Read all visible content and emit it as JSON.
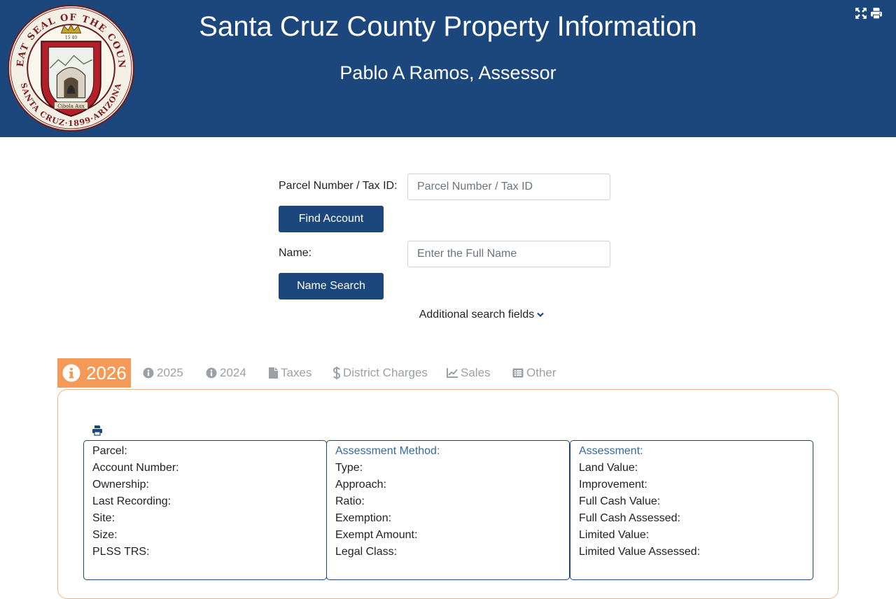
{
  "header": {
    "title": "Santa Cruz County Property Information",
    "subtitle": "Pablo A Ramos, Assessor",
    "seal": {
      "top_text": "GREAT SEAL OF THE COUNTY",
      "bottom_text": "SANTA CRUZ · 1899 · ARIZONA",
      "year": "1540",
      "motto": "Cibola Aux"
    }
  },
  "search": {
    "parcel_label": "Parcel Number / Tax ID:",
    "parcel_placeholder": "Parcel Number / Tax ID",
    "parcel_value": "",
    "find_button": "Find Account",
    "name_label": "Name:",
    "name_placeholder": "Enter the Full Name",
    "name_value": "",
    "name_button": "Name Search",
    "additional_fields": "Additional search fields"
  },
  "tabs": [
    {
      "label": "2026",
      "icon": "info-circle-icon",
      "active": true
    },
    {
      "label": "2025",
      "icon": "info-circle-icon",
      "active": false
    },
    {
      "label": "2024",
      "icon": "info-circle-icon",
      "active": false
    },
    {
      "label": "Taxes",
      "icon": "file-icon",
      "active": false
    },
    {
      "label": "District Charges",
      "icon": "dollar-icon",
      "active": false
    },
    {
      "label": "Sales",
      "icon": "chart-line-icon",
      "active": false
    },
    {
      "label": "Other",
      "icon": "list-alt-icon",
      "active": false
    }
  ],
  "details": {
    "property": [
      "Parcel:",
      "Account Number:",
      "Ownership:",
      "Last Recording:",
      "Site:",
      "Size:",
      "PLSS TRS:"
    ],
    "method": {
      "heading": "Assessment Method:",
      "rows": [
        "Type:",
        "Approach:",
        "Ratio:",
        "Exemption:",
        "Exempt Amount:",
        "Legal Class:"
      ]
    },
    "assessment": {
      "heading": "Assessment:",
      "rows": [
        "Land Value:",
        "Improvement:",
        "Full Cash Value:",
        "Full Cash Assessed:",
        "Limited Value:",
        "Limited Value Assessed:"
      ]
    }
  },
  "colors": {
    "header_bg": "#1c477d",
    "button_bg": "#1c477d",
    "active_tab": "#f39a58",
    "inactive_tab_text": "#9aa0a6",
    "panel_border": "#e8b48c",
    "heading_text": "#356aa0"
  }
}
